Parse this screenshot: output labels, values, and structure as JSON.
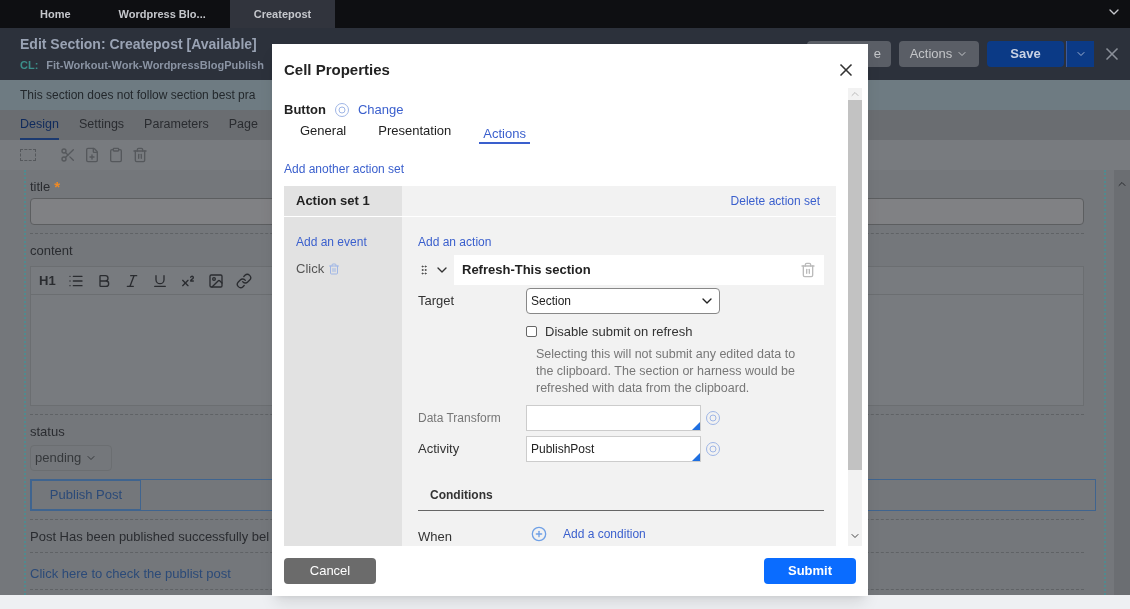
{
  "top_tabs": [
    {
      "label": "Home",
      "selected": false
    },
    {
      "label": "Wordpress Blo...",
      "selected": false
    },
    {
      "label": "Createpost",
      "selected": true
    }
  ],
  "header": {
    "title": "Edit Section: Createpost [Available]",
    "class_label": "CL:",
    "class_name": "Fit-Workout-Work-WordpressBlogPublish",
    "buttons": [
      {
        "label": "e",
        "kind": "plain"
      },
      {
        "label": "Actions",
        "kind": "menu"
      },
      {
        "label": "Save",
        "kind": "primary"
      }
    ]
  },
  "warning": "This section does not follow section best pra",
  "designer_tabs": [
    {
      "label": "Design",
      "selected": true
    },
    {
      "label": "Settings",
      "selected": false
    },
    {
      "label": "Parameters",
      "selected": false
    },
    {
      "label": "Page",
      "selected": false
    }
  ],
  "form": {
    "title_label": "title",
    "title_required_mark": "*",
    "content_label": "content",
    "rte_heading": "H1",
    "status_label": "status",
    "status_value": "pending",
    "button": "Publish Post",
    "message": "Post Has been published successfully bel",
    "link": "Click here to check the publist post"
  },
  "dialog": {
    "title": "Cell Properties",
    "control_type": "Button",
    "change_link": "Change",
    "tabs": [
      {
        "label": "General",
        "selected": false
      },
      {
        "label": "Presentation",
        "selected": false
      },
      {
        "label": "Actions",
        "selected": true
      }
    ],
    "add_set_link": "Add another action set",
    "action_set": {
      "title": "Action set 1",
      "delete_link": "Delete action set",
      "add_event": "Add an event",
      "events": [
        {
          "label": "Click"
        }
      ],
      "add_action": "Add an action",
      "action": {
        "title": "Refresh-This section",
        "expanded": true,
        "target_label": "Target",
        "target_value": "Section",
        "checkbox_label": "Disable submit on refresh",
        "checkbox_checked": false,
        "help": "Selecting this will not submit any edited data to the clipboard. The section or harness would be refreshed with data from the clipboard.",
        "data_transform_label": "Data Transform",
        "activity_label": "Activity",
        "activity_value": "PublishPost",
        "conditions_heading": "Conditions",
        "when_label": "When",
        "add_condition": "Add a condition"
      }
    },
    "cancel": "Cancel",
    "submit": "Submit"
  }
}
